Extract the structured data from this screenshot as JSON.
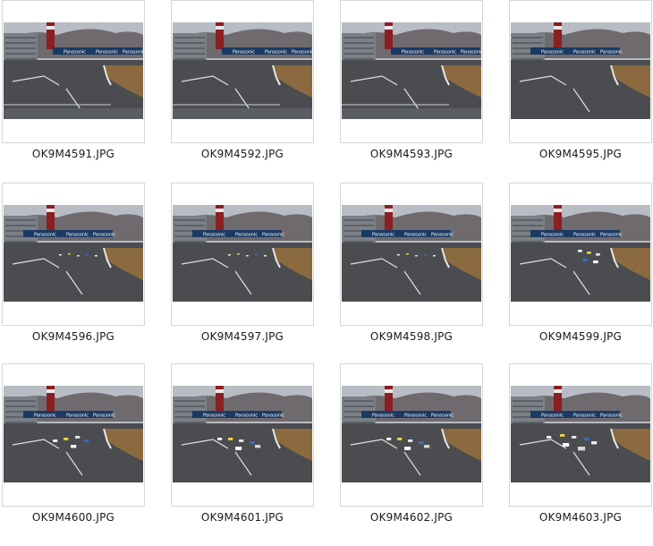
{
  "view": "thumbnails",
  "files": [
    {
      "name": "OK9M4591.JPG",
      "variant": "start"
    },
    {
      "name": "OK9M4592.JPG",
      "variant": "start"
    },
    {
      "name": "OK9M4593.JPG",
      "variant": "start"
    },
    {
      "name": "OK9M4595.JPG",
      "variant": "empty-close"
    },
    {
      "name": "OK9M4596.JPG",
      "variant": "cars-far"
    },
    {
      "name": "OK9M4597.JPG",
      "variant": "cars-far"
    },
    {
      "name": "OK9M4598.JPG",
      "variant": "cars-far"
    },
    {
      "name": "OK9M4599.JPG",
      "variant": "cars-close"
    },
    {
      "name": "OK9M4600.JPG",
      "variant": "cars-mid"
    },
    {
      "name": "OK9M4601.JPG",
      "variant": "cars-near"
    },
    {
      "name": "OK9M4602.JPG",
      "variant": "cars-near"
    },
    {
      "name": "OK9M4603.JPG",
      "variant": "cars-nearest"
    }
  ],
  "banner_text": "Panasonic",
  "colors": {
    "sky": "#b8bcc4",
    "hill": "#6f6a6d",
    "asphalt": "#4a4c50",
    "grass": "#8a6a3e",
    "banner": "#1b3a63",
    "tower": "#8a1f24"
  }
}
